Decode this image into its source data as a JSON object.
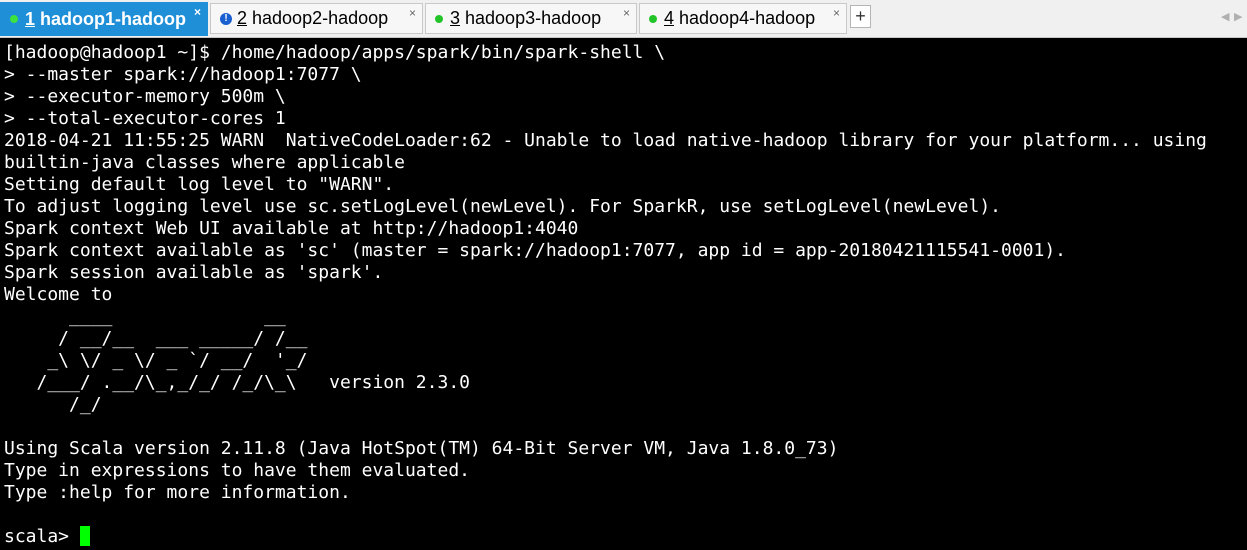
{
  "tabs": [
    {
      "num": "1",
      "title": "hadoop1-hadoop",
      "close": "×"
    },
    {
      "num": "2",
      "title": "hadoop2-hadoop",
      "close": "×"
    },
    {
      "num": "3",
      "title": "hadoop3-hadoop",
      "close": "×"
    },
    {
      "num": "4",
      "title": "hadoop4-hadoop",
      "close": "×"
    }
  ],
  "add_tab": "+",
  "nav": {
    "left": "◀",
    "right": "▶"
  },
  "colors": {
    "active_tab": "#1f8fd8",
    "cursor": "#00ff00",
    "terminal_bg": "#000000"
  },
  "terminal": {
    "lines": [
      "[hadoop@hadoop1 ~]$ /home/hadoop/apps/spark/bin/spark-shell \\",
      "> --master spark://hadoop1:7077 \\",
      "> --executor-memory 500m \\",
      "> --total-executor-cores 1",
      "2018-04-21 11:55:25 WARN  NativeCodeLoader:62 - Unable to load native-hadoop library for your platform... using",
      "builtin-java classes where applicable",
      "Setting default log level to \"WARN\".",
      "To adjust logging level use sc.setLogLevel(newLevel). For SparkR, use setLogLevel(newLevel).",
      "Spark context Web UI available at http://hadoop1:4040",
      "Spark context available as 'sc' (master = spark://hadoop1:7077, app id = app-20180421115541-0001).",
      "Spark session available as 'spark'.",
      "Welcome to",
      "      ____              __",
      "     / __/__  ___ _____/ /__",
      "    _\\ \\/ _ \\/ _ `/ __/  '_/",
      "   /___/ .__/\\_,_/_/ /_/\\_\\   version 2.3.0",
      "      /_/",
      "",
      "Using Scala version 2.11.8 (Java HotSpot(TM) 64-Bit Server VM, Java 1.8.0_73)",
      "Type in expressions to have them evaluated.",
      "Type :help for more information.",
      ""
    ],
    "prompt": "scala> "
  }
}
